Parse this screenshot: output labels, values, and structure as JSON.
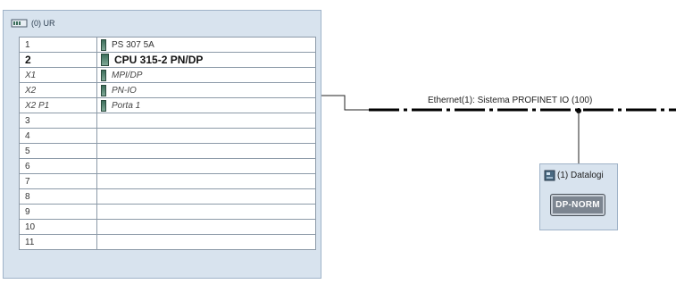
{
  "rack": {
    "title": "(0) UR",
    "slots": [
      {
        "slot": "1",
        "module": "PS 307 5A",
        "has_icon": true
      },
      {
        "slot": "2",
        "module": "CPU 315-2 PN/DP",
        "has_icon": true
      },
      {
        "slot": "X1",
        "module": "MPI/DP",
        "has_icon": true
      },
      {
        "slot": "X2",
        "module": "PN-IO",
        "has_icon": true
      },
      {
        "slot": "X2 P1",
        "module": "Porta 1",
        "has_icon": true
      },
      {
        "slot": "3",
        "module": "",
        "has_icon": false
      },
      {
        "slot": "4",
        "module": "",
        "has_icon": false
      },
      {
        "slot": "5",
        "module": "",
        "has_icon": false
      },
      {
        "slot": "6",
        "module": "",
        "has_icon": false
      },
      {
        "slot": "7",
        "module": "",
        "has_icon": false
      },
      {
        "slot": "8",
        "module": "",
        "has_icon": false
      },
      {
        "slot": "9",
        "module": "",
        "has_icon": false
      },
      {
        "slot": "10",
        "module": "",
        "has_icon": false
      },
      {
        "slot": "11",
        "module": "",
        "has_icon": false
      }
    ]
  },
  "network": {
    "label": "Ethernet(1): Sistema PROFINET IO (100)"
  },
  "device": {
    "title": "(1) Datalogi",
    "button_label": "DP-NORM"
  },
  "icons": {
    "rack": "rack-icon",
    "module": "module-icon",
    "device": "device-icon"
  }
}
